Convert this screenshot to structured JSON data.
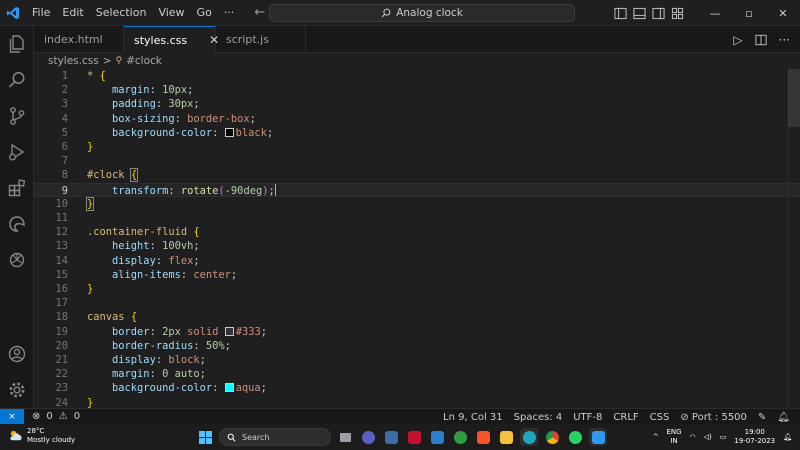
{
  "titlebar": {
    "menu": [
      "File",
      "Edit",
      "Selection",
      "View",
      "Go",
      "···"
    ],
    "search_text": "Analog clock",
    "window_controls": [
      "—",
      "▫",
      "✕"
    ]
  },
  "tabs": [
    {
      "label": "index.html",
      "active": false
    },
    {
      "label": "styles.css",
      "active": true,
      "close": "✕"
    },
    {
      "label": "script.js",
      "active": false
    }
  ],
  "breadcrumb": {
    "file": "styles.css",
    "separator": ">",
    "symbol": "#clock"
  },
  "code_lines": [
    {
      "n": "1"
    },
    {
      "n": "2"
    },
    {
      "n": "3"
    },
    {
      "n": "4"
    },
    {
      "n": "5"
    },
    {
      "n": "6"
    },
    {
      "n": "7"
    },
    {
      "n": "8"
    },
    {
      "n": "9"
    },
    {
      "n": "10"
    },
    {
      "n": "11"
    },
    {
      "n": "12"
    },
    {
      "n": "13"
    },
    {
      "n": "14"
    },
    {
      "n": "15"
    },
    {
      "n": "16"
    },
    {
      "n": "17"
    },
    {
      "n": "18"
    },
    {
      "n": "19"
    },
    {
      "n": "20"
    },
    {
      "n": "21"
    },
    {
      "n": "22"
    },
    {
      "n": "23"
    },
    {
      "n": "24"
    }
  ],
  "code": {
    "l1_sel": "*",
    "l1_brace": "{",
    "l2_prop": "margin",
    "l2_val": "10px",
    "l3_prop": "padding",
    "l3_val": "30px",
    "l4_prop": "box-sizing",
    "l4_val": "border-box",
    "l5_prop": "background-color",
    "l5_val": "black",
    "l6_brace": "}",
    "l8_sel": "#clock",
    "l8_brace": "{",
    "l9_prop": "transform",
    "l9_fn": "rotate",
    "l9_open": "(",
    "l9_val": "-90deg",
    "l9_close": ")",
    "l10_brace": "}",
    "l12_sel": ".container-fluid",
    "l12_brace": "{",
    "l13_prop": "height",
    "l13_val": "100vh",
    "l14_prop": "display",
    "l14_val": "flex",
    "l15_prop": "align-items",
    "l15_val": "center",
    "l16_brace": "}",
    "l18_sel": "canvas",
    "l18_brace": "{",
    "l19_prop": "border",
    "l19_num": "2px",
    "l19_val": "solid",
    "l19_color": "#333",
    "l20_prop": "border-radius",
    "l20_val": "50%",
    "l21_prop": "display",
    "l21_val": "block",
    "l22_prop": "margin",
    "l22_val": "0 auto",
    "l23_prop": "background-color",
    "l23_val": "aqua",
    "l24_brace": "}"
  },
  "colors": {
    "black_swatch": "#000000",
    "dark_swatch": "#333333",
    "aqua_swatch": "#00ffff",
    "accent": "#0078d4"
  },
  "statusbar": {
    "errors": "0",
    "warnings": "0",
    "position": "Ln 9, Col 31",
    "spaces": "Spaces: 4",
    "encoding": "UTF-8",
    "eol": "CRLF",
    "language": "CSS",
    "port": "Port : 5500"
  },
  "taskbar": {
    "temperature": "28°C",
    "weather": "Mostly cloudy",
    "search_placeholder": "Search",
    "lang_line1": "ENG",
    "lang_line2": "IN",
    "time": "19:00",
    "date": "19-07-2023"
  }
}
